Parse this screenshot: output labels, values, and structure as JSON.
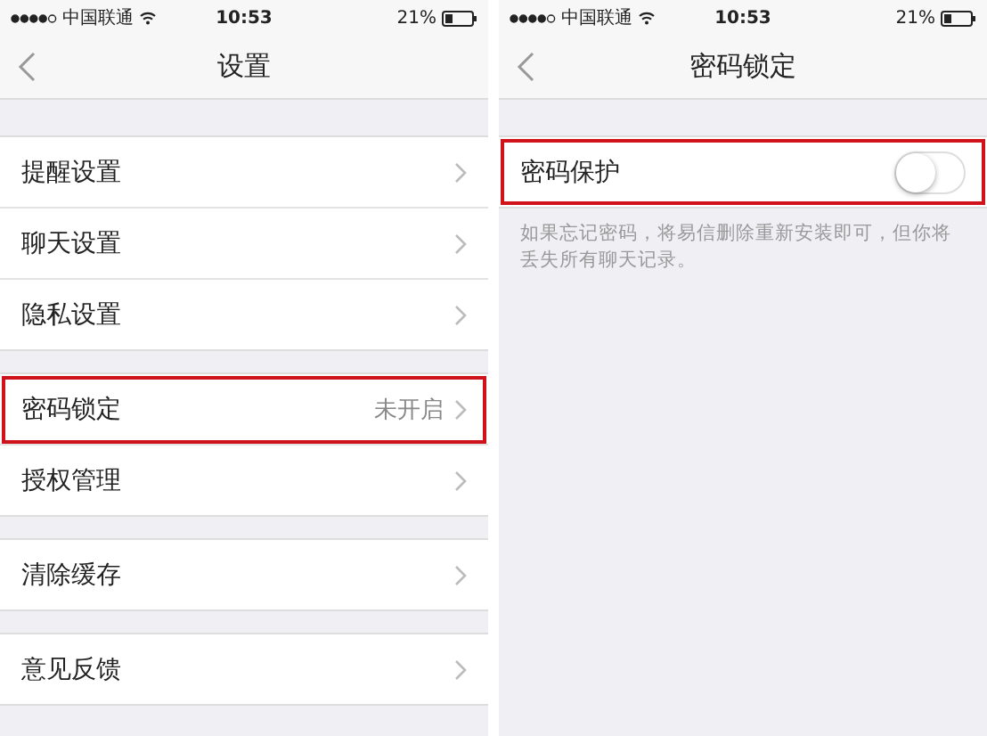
{
  "screens": [
    {
      "status_bar": {
        "carrier": "中国联通",
        "time": "10:53",
        "battery": "21%"
      },
      "title": "设置",
      "groups": [
        [
          {
            "kind": "link",
            "label": "提醒设置",
            "highlighted": false
          },
          {
            "kind": "link",
            "label": "聊天设置",
            "highlighted": false
          },
          {
            "kind": "link",
            "label": "隐私设置",
            "highlighted": false
          }
        ],
        [
          {
            "kind": "link",
            "label": "密码锁定",
            "value": "未开启",
            "highlighted": true
          },
          {
            "kind": "link",
            "label": "授权管理",
            "highlighted": false
          }
        ],
        [
          {
            "kind": "link",
            "label": "清除缓存",
            "highlighted": false
          }
        ],
        [
          {
            "kind": "link",
            "label": "意见反馈",
            "highlighted": false
          }
        ]
      ]
    },
    {
      "status_bar": {
        "carrier": "中国联通",
        "time": "10:53",
        "battery": "21%"
      },
      "title": "密码锁定",
      "groups": [
        [
          {
            "kind": "toggle",
            "label": "密码保护",
            "on": false,
            "highlighted": true
          }
        ]
      ],
      "note": "如果忘记密码，将易信删除重新安装即可，但你将丢失所有聊天记录。"
    }
  ]
}
